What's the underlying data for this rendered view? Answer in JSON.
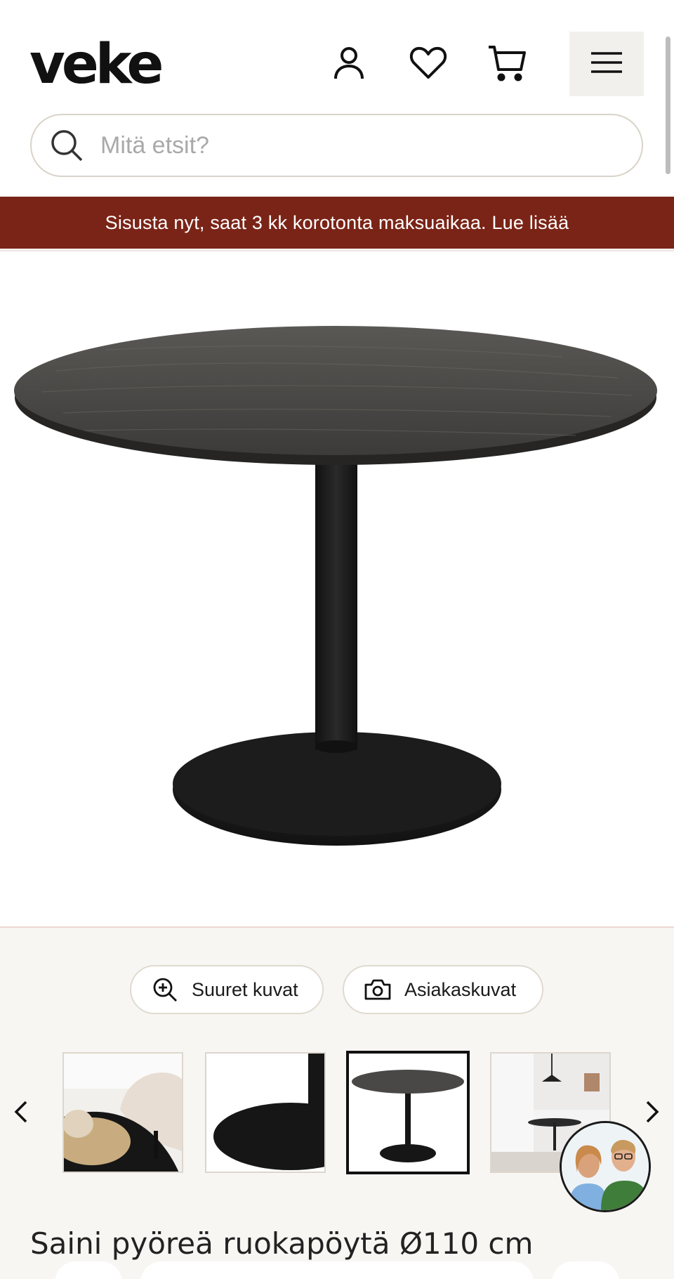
{
  "header": {
    "logo_text": "veke",
    "account_icon": "user-icon",
    "wishlist_icon": "heart-icon",
    "cart_icon": "cart-icon",
    "menu_icon": "hamburger-menu-icon"
  },
  "search": {
    "placeholder": "Mitä etsit?",
    "value": "",
    "icon": "search-icon"
  },
  "promo_banner": {
    "text": "Sisusta nyt, saat 3 kk korotonta maksuaikaa. Lue lisää",
    "background": "#7a2417"
  },
  "gallery": {
    "large_images_label": "Suuret kuvat",
    "customer_images_label": "Asiakaskuvat",
    "thumbnails": [
      {
        "name": "thumbnail-detail-chair"
      },
      {
        "name": "thumbnail-base-closeup"
      },
      {
        "name": "thumbnail-table-full",
        "active": true
      },
      {
        "name": "thumbnail-kitchen-scene"
      }
    ]
  },
  "product": {
    "title": "Saini pyöreä ruokapöytä Ø110 cm"
  },
  "colors": {
    "brand_banner": "#7a2417",
    "background_gallery": "#f8f6f3",
    "border_light": "#d9d4c9"
  }
}
